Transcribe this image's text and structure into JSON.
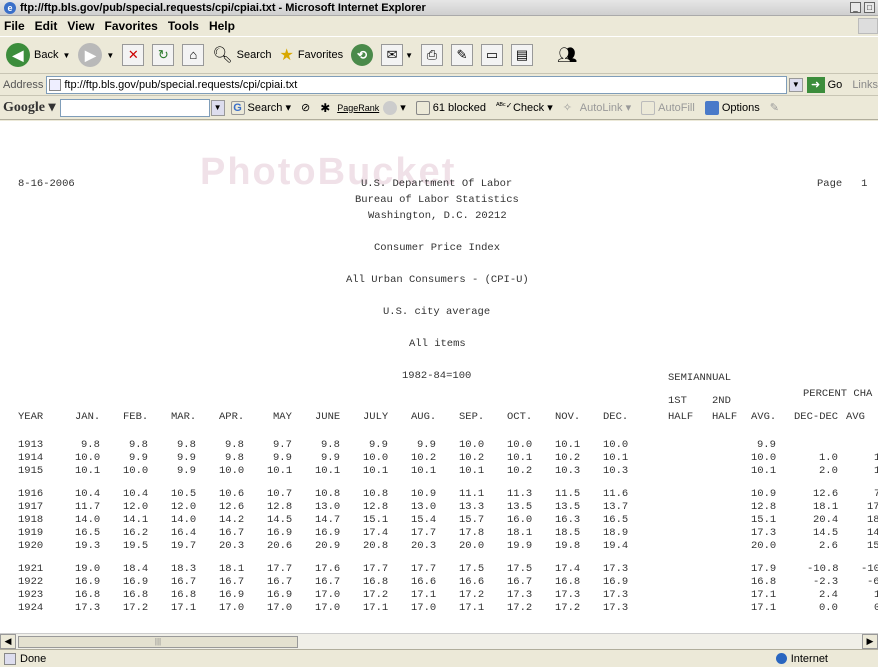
{
  "window": {
    "title": "ftp://ftp.bls.gov/pub/special.requests/cpi/cpiai.txt - Microsoft Internet Explorer"
  },
  "menu": [
    "File",
    "Edit",
    "View",
    "Favorites",
    "Tools",
    "Help"
  ],
  "toolbar": {
    "back_label": "Back",
    "search_label": "Search",
    "favorites_label": "Favorites"
  },
  "address": {
    "label": "Address",
    "value": "ftp://ftp.bls.gov/pub/special.requests/cpi/cpiai.txt",
    "go_label": "Go",
    "links_label": "Links"
  },
  "google": {
    "logo": "Google",
    "search_label": "Search",
    "pagerank_label": "PageRank",
    "blocked_label": "61 blocked",
    "check_label": "Check",
    "autolink_label": "AutoLink",
    "autofill_label": "AutoFill",
    "options_label": "Options"
  },
  "watermark": "PhotoBucket",
  "document": {
    "date": "8-16-2006",
    "page_label": "Page   1",
    "header_lines": [
      "U.S. Department Of Labor",
      "Bureau of Labor Statistics",
      "Washington, D.C. 20212",
      "",
      "Consumer Price Index",
      "",
      "All Urban Consumers - (CPI-U)",
      "",
      "U.S. city average",
      "",
      "All items",
      "",
      "1982-84=100"
    ],
    "semiannual_label": "SEMIANNUAL",
    "percent_label": "PERCENT CHA",
    "columns": [
      "YEAR",
      "JAN.",
      "FEB.",
      "MAR.",
      "APR.",
      "MAY",
      "JUNE",
      "JULY",
      "AUG.",
      "SEP.",
      "OCT.",
      "NOV.",
      "DEC.",
      "1ST HALF",
      "2ND HALF",
      "AVG.",
      "DEC-DEC",
      "AVG"
    ],
    "rows": [
      {
        "year": "1913",
        "m": [
          "9.8",
          "9.8",
          "9.8",
          "9.8",
          "9.7",
          "9.8",
          "9.9",
          "9.9",
          "10.0",
          "10.0",
          "10.1",
          "10.0"
        ],
        "avg": "9.9",
        "decdec": "",
        "avgpct": ""
      },
      {
        "year": "1914",
        "m": [
          "10.0",
          "9.9",
          "9.9",
          "9.8",
          "9.9",
          "9.9",
          "10.0",
          "10.2",
          "10.2",
          "10.1",
          "10.2",
          "10.1"
        ],
        "avg": "10.0",
        "decdec": "1.0",
        "avgpct": "1"
      },
      {
        "year": "1915",
        "m": [
          "10.1",
          "10.0",
          "9.9",
          "10.0",
          "10.1",
          "10.1",
          "10.1",
          "10.1",
          "10.1",
          "10.2",
          "10.3",
          "10.3"
        ],
        "avg": "10.1",
        "decdec": "2.0",
        "avgpct": "1"
      },
      {
        "year": "1916",
        "m": [
          "10.4",
          "10.4",
          "10.5",
          "10.6",
          "10.7",
          "10.8",
          "10.8",
          "10.9",
          "11.1",
          "11.3",
          "11.5",
          "11.6"
        ],
        "avg": "10.9",
        "decdec": "12.6",
        "avgpct": "7"
      },
      {
        "year": "1917",
        "m": [
          "11.7",
          "12.0",
          "12.0",
          "12.6",
          "12.8",
          "13.0",
          "12.8",
          "13.0",
          "13.3",
          "13.5",
          "13.5",
          "13.7"
        ],
        "avg": "12.8",
        "decdec": "18.1",
        "avgpct": "17"
      },
      {
        "year": "1918",
        "m": [
          "14.0",
          "14.1",
          "14.0",
          "14.2",
          "14.5",
          "14.7",
          "15.1",
          "15.4",
          "15.7",
          "16.0",
          "16.3",
          "16.5"
        ],
        "avg": "15.1",
        "decdec": "20.4",
        "avgpct": "18"
      },
      {
        "year": "1919",
        "m": [
          "16.5",
          "16.2",
          "16.4",
          "16.7",
          "16.9",
          "16.9",
          "17.4",
          "17.7",
          "17.8",
          "18.1",
          "18.5",
          "18.9"
        ],
        "avg": "17.3",
        "decdec": "14.5",
        "avgpct": "14"
      },
      {
        "year": "1920",
        "m": [
          "19.3",
          "19.5",
          "19.7",
          "20.3",
          "20.6",
          "20.9",
          "20.8",
          "20.3",
          "20.0",
          "19.9",
          "19.8",
          "19.4"
        ],
        "avg": "20.0",
        "decdec": "2.6",
        "avgpct": "15"
      },
      {
        "year": "1921",
        "m": [
          "19.0",
          "18.4",
          "18.3",
          "18.1",
          "17.7",
          "17.6",
          "17.7",
          "17.7",
          "17.5",
          "17.5",
          "17.4",
          "17.3"
        ],
        "avg": "17.9",
        "decdec": "-10.8",
        "avgpct": "-10"
      },
      {
        "year": "1922",
        "m": [
          "16.9",
          "16.9",
          "16.7",
          "16.7",
          "16.7",
          "16.7",
          "16.8",
          "16.6",
          "16.6",
          "16.7",
          "16.8",
          "16.9"
        ],
        "avg": "16.8",
        "decdec": "-2.3",
        "avgpct": "-6"
      },
      {
        "year": "1923",
        "m": [
          "16.8",
          "16.8",
          "16.8",
          "16.9",
          "16.9",
          "17.0",
          "17.2",
          "17.1",
          "17.2",
          "17.3",
          "17.3",
          "17.3"
        ],
        "avg": "17.1",
        "decdec": "2.4",
        "avgpct": "1"
      },
      {
        "year": "1924",
        "m": [
          "17.3",
          "17.2",
          "17.1",
          "17.0",
          "17.0",
          "17.0",
          "17.1",
          "17.0",
          "17.1",
          "17.2",
          "17.2",
          "17.3"
        ],
        "avg": "17.1",
        "decdec": "0.0",
        "avgpct": "0"
      }
    ]
  },
  "status": {
    "left": "Done",
    "zone": "Internet"
  }
}
